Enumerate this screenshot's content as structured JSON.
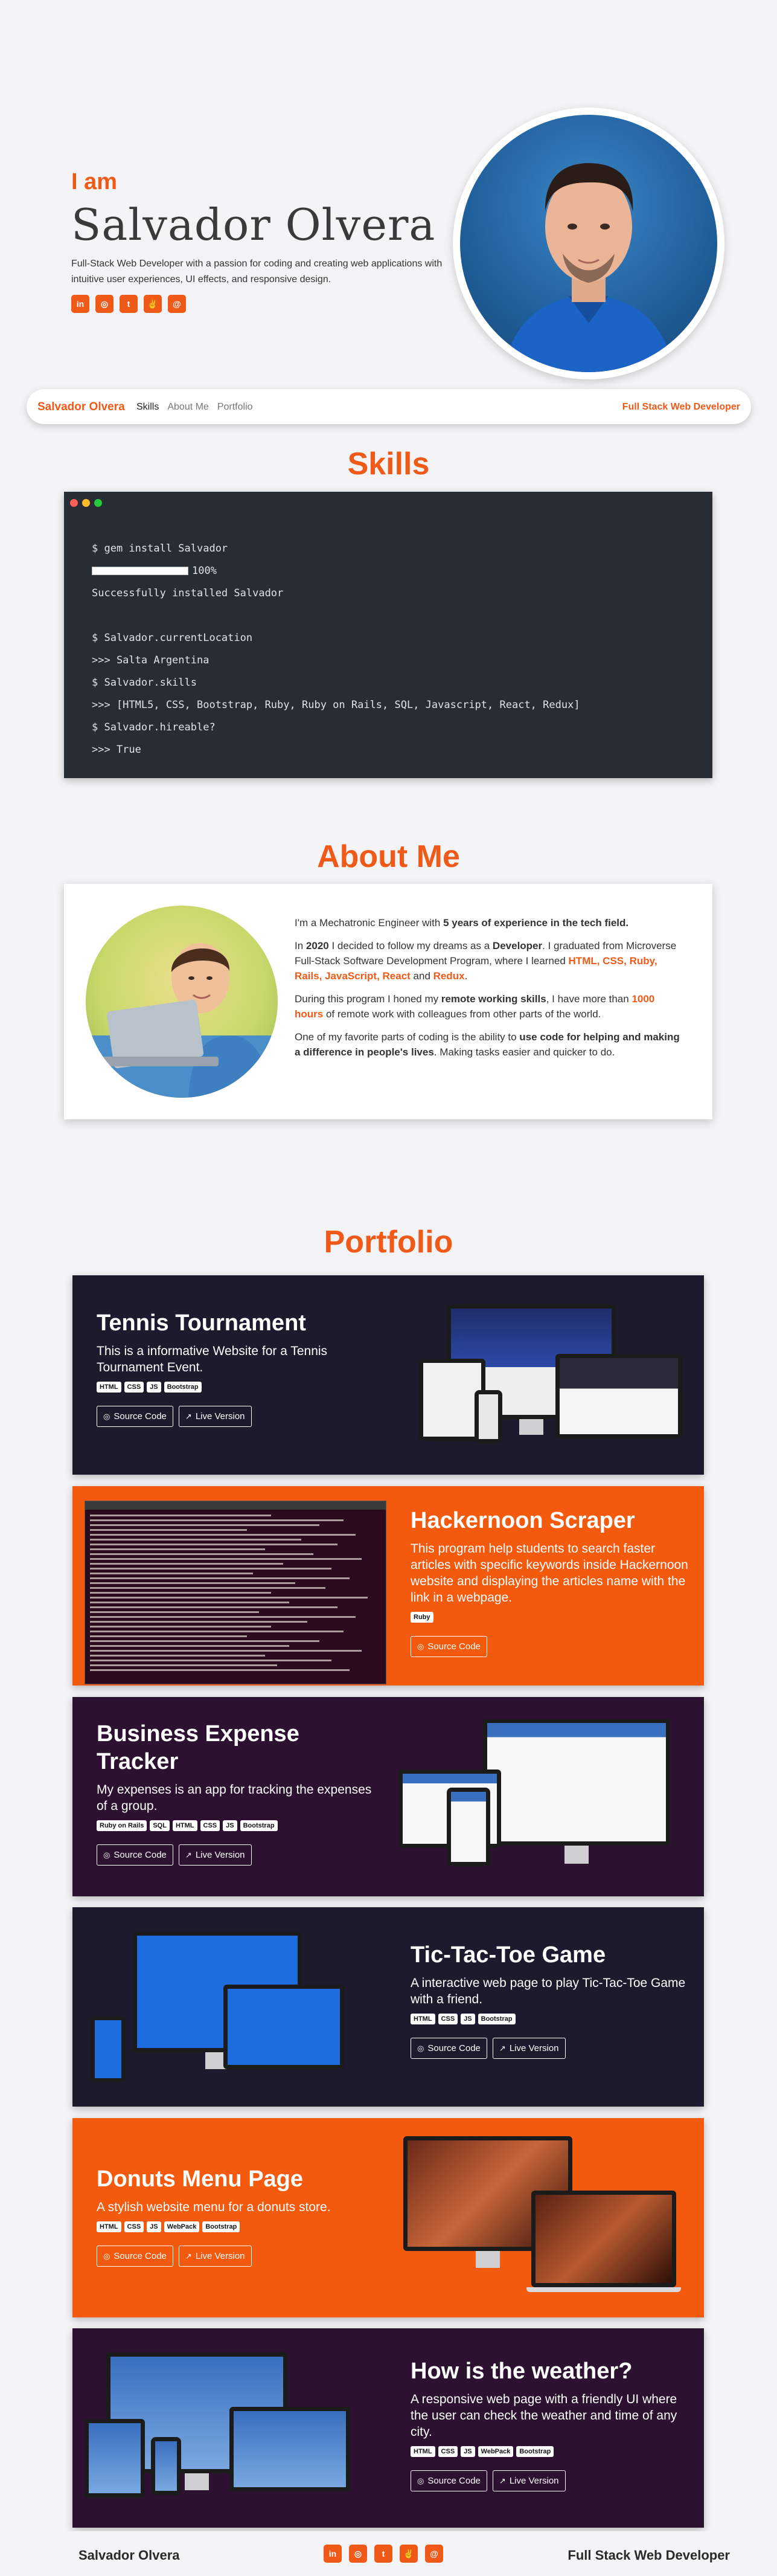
{
  "hero": {
    "greeting": "I am",
    "name": "Salvador Olvera",
    "description": "Full-Stack Web Developer with a passion for coding and creating web applications with intuitive user experiences, UI effects, and responsive design.",
    "socials": [
      {
        "icon": "linkedin-icon",
        "glyph": "in"
      },
      {
        "icon": "github-icon",
        "glyph": "◎"
      },
      {
        "icon": "twitter-icon",
        "glyph": "t"
      },
      {
        "icon": "angellist-icon",
        "glyph": "✌"
      },
      {
        "icon": "email-icon",
        "glyph": "@"
      }
    ]
  },
  "nav": {
    "brand": "Salvador Olvera",
    "links": [
      "Skills",
      "About Me",
      "Portfolio"
    ],
    "role": "Full Stack Web Developer"
  },
  "skills": {
    "title": "Skills",
    "lines": [
      "$ gem install Salvador",
      "100%",
      "Successfully installed Salvador",
      "",
      "$ Salvador.currentLocation",
      ">>> Salta Argentina",
      "$ Salvador.skills",
      ">>> [HTML5, CSS, Bootstrap, Ruby, Ruby on Rails, SQL, Javascript, React, Redux]",
      "$ Salvador.hireable?",
      ">>> True"
    ]
  },
  "about": {
    "title": "About Me",
    "p1_a": "I'm a Mechatronic Engineer with ",
    "p1_b": "5 years of experience in the tech field.",
    "p2_a": "In ",
    "p2_b": "2020",
    "p2_c": " I decided to follow my dreams as a ",
    "p2_d": "Developer",
    "p2_e": ". I graduated from Microverse Full-Stack Software Development Program, where I learned ",
    "p2_f": "HTML, CSS, Ruby, Rails, JavaScript, React",
    "p2_g": " and ",
    "p2_h": "Redux",
    "p2_i": ".",
    "p3_a": "During this program I honed my ",
    "p3_b": "remote working skills",
    "p3_c": ", I have more than ",
    "p3_d": "1000 hours",
    "p3_e": " of remote work with colleagues from other parts of the world.",
    "p4_a": "One of my favorite parts of coding is the ability to ",
    "p4_b": "use code for helping and making a difference in people's lives",
    "p4_c": ". Making tasks easier and quicker to do."
  },
  "portfolio": {
    "title": "Portfolio",
    "source_label": "Source Code",
    "live_label": "Live Version",
    "projects": [
      {
        "title": "Tennis Tournament",
        "description": "This is a informative Website for a Tennis Tournament Event.",
        "tags": [
          "HTML",
          "CSS",
          "JS",
          "Bootstrap"
        ],
        "bg": "#1c1a2c"
      },
      {
        "title": "Hackernoon Scraper",
        "description": "This program help students to search faster articles with specific keywords inside Hackernoon website and displaying the articles name with the link in a webpage.",
        "tags": [
          "Ruby"
        ],
        "bg": "#f45a0e"
      },
      {
        "title": "Business Expense Tracker",
        "description": "My expenses is an app for tracking the expenses of a group.",
        "tags": [
          "Ruby on Rails",
          "SQL",
          "HTML",
          "CSS",
          "JS",
          "Bootstrap"
        ],
        "bg": "#2c1130"
      },
      {
        "title": "Tic-Tac-Toe Game",
        "description": "A interactive web page to play Tic-Tac-Toe Game with a friend.",
        "tags": [
          "HTML",
          "CSS",
          "JS",
          "Bootstrap"
        ],
        "bg": "#1c1a2c"
      },
      {
        "title": "Donuts Menu Page",
        "description": "A stylish website menu for a donuts store.",
        "tags": [
          "HTML",
          "CSS",
          "JS",
          "WebPack",
          "Bootstrap"
        ],
        "bg": "#f45a0e"
      },
      {
        "title": "How is the weather?",
        "description": "A responsive web page with a friendly UI where the user can check the weather and time of any city.",
        "tags": [
          "HTML",
          "CSS",
          "JS",
          "WebPack",
          "Bootstrap"
        ],
        "bg": "#2c1130"
      }
    ]
  },
  "footer": {
    "name": "Salvador Olvera",
    "role": "Full Stack Web Developer"
  },
  "colors": {
    "accent": "#f05a19",
    "terminal_bg": "#282c34"
  }
}
